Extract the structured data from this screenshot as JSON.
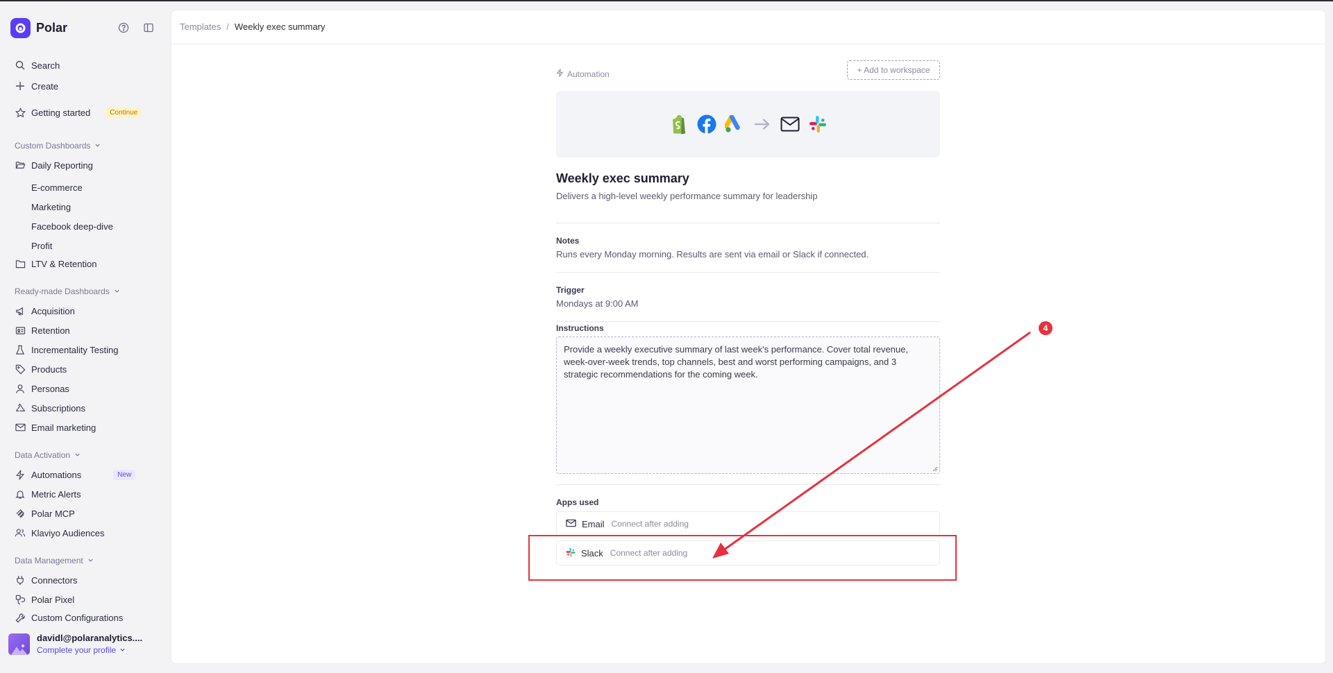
{
  "app": {
    "name": "Polar"
  },
  "sidebar": {
    "top_items": [
      {
        "label": "Search",
        "icon": "search-icon"
      },
      {
        "label": "Create",
        "icon": "plus-icon"
      },
      {
        "label": "Getting started",
        "icon": "star-icon",
        "badge": "Continue"
      }
    ],
    "custom_dashboards": {
      "title": "Custom Dashboards",
      "folders": [
        {
          "label": "Daily Reporting",
          "children": [
            "E-commerce",
            "Marketing",
            "Facebook deep-dive",
            "Profit"
          ]
        },
        {
          "label": "LTV & Retention"
        }
      ]
    },
    "ready_made": {
      "title": "Ready-made Dashboards",
      "items": [
        {
          "label": "Acquisition",
          "icon": "megaphone-icon"
        },
        {
          "label": "Retention",
          "icon": "id-card-icon"
        },
        {
          "label": "Incrementality Testing",
          "icon": "flask-icon"
        },
        {
          "label": "Products",
          "icon": "tag-icon"
        },
        {
          "label": "Personas",
          "icon": "user-icon"
        },
        {
          "label": "Subscriptions",
          "icon": "recycle-icon"
        },
        {
          "label": "Email marketing",
          "icon": "mail-icon"
        }
      ]
    },
    "data_activation": {
      "title": "Data Activation",
      "items": [
        {
          "label": "Automations",
          "icon": "zap-icon",
          "badge": "New"
        },
        {
          "label": "Metric Alerts",
          "icon": "bell-icon"
        },
        {
          "label": "Polar MCP",
          "icon": "mcp-icon"
        },
        {
          "label": "Klaviyo Audiences",
          "icon": "users-icon"
        }
      ]
    },
    "data_management": {
      "title": "Data Management",
      "items": [
        {
          "label": "Connectors",
          "icon": "plug-icon"
        },
        {
          "label": "Polar Pixel",
          "icon": "pixel-icon"
        },
        {
          "label": "Custom Configurations",
          "icon": "wrench-icon"
        }
      ]
    },
    "user": {
      "email": "davidl@polaranalytics....",
      "profile_link": "Complete your profile"
    }
  },
  "breadcrumb": {
    "parent": "Templates",
    "separator": "/",
    "current": "Weekly exec summary"
  },
  "template": {
    "category": "Automation",
    "add_button": "+ Add to workspace",
    "hero_apps": [
      "shopify-icon",
      "facebook-icon",
      "google-ads-icon",
      "arrow-right-icon",
      "mail-icon",
      "slack-icon"
    ],
    "title": "Weekly exec summary",
    "description": "Delivers a high-level weekly performance summary for leadership",
    "notes_label": "Notes",
    "notes": "Runs every Monday morning. Results are sent via email or Slack if connected.",
    "trigger_label": "Trigger",
    "trigger": "Mondays at 9:00 AM",
    "instructions_label": "Instructions",
    "instructions": "Provide a weekly executive summary of last week's performance. Cover total revenue, week-over-week trends, top channels, best and worst performing campaigns, and 3 strategic recommendations for the coming week.",
    "apps_label": "Apps used",
    "apps": [
      {
        "name": "Email",
        "hint": "Connect after adding",
        "icon": "mail-icon"
      },
      {
        "name": "Slack",
        "hint": "Connect after adding",
        "icon": "slack-icon"
      }
    ]
  },
  "annotation": {
    "step": "4",
    "color": "#e5323f"
  },
  "colors": {
    "brand": "#5b3df5",
    "badge_continue_bg": "#fff3c8",
    "badge_new_bg": "#e9e7fb"
  }
}
